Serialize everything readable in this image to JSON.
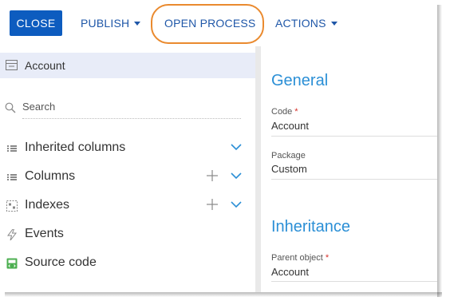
{
  "toolbar": {
    "close_label": "CLOSE",
    "publish_label": "PUBLISH",
    "open_process_label": "OPEN PROCESS",
    "actions_label": "ACTIONS"
  },
  "sidebar": {
    "selected_item": "Account",
    "search_placeholder": "Search",
    "items": [
      {
        "label": "Inherited columns",
        "icon": "columns-list-icon"
      },
      {
        "label": "Columns",
        "icon": "columns-list-icon"
      },
      {
        "label": "Indexes",
        "icon": "indexes-icon"
      },
      {
        "label": "Events",
        "icon": "lightning-icon"
      },
      {
        "label": "Source code",
        "icon": "source-code-icon"
      }
    ]
  },
  "properties": {
    "general_heading": "General",
    "code_label": "Code",
    "code_value": "Account",
    "package_label": "Package",
    "package_value": "Custom",
    "inheritance_heading": "Inheritance",
    "parent_label": "Parent object",
    "parent_value": "Account",
    "required_marker": "*"
  },
  "colors": {
    "primary": "#0d5cbf",
    "link": "#1f57a8",
    "heading": "#2b8fd6",
    "highlight": "#ea8a2e",
    "required": "#d6302a",
    "selected_row": "#e8ecf8"
  }
}
